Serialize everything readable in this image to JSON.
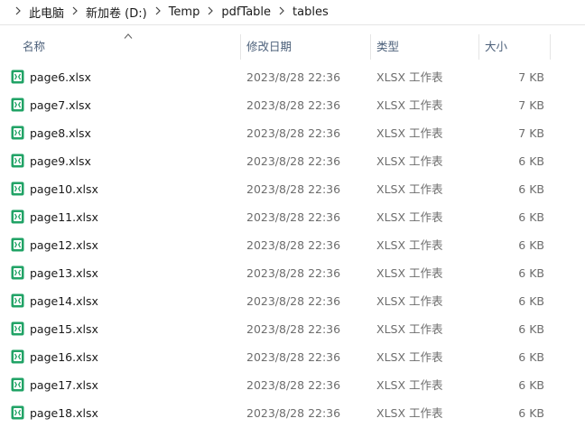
{
  "breadcrumb": [
    "此电脑",
    "新加卷 (D:)",
    "Temp",
    "pdfTable",
    "tables"
  ],
  "columns": {
    "name": "名称",
    "date": "修改日期",
    "type": "类型",
    "size": "大小"
  },
  "icons": {
    "breadcrumb_separator": "chevron-right-icon",
    "sort": "sort-ascending-icon",
    "file": "excel-file-icon"
  },
  "colors": {
    "file_icon": "#21a366",
    "header_text": "#4c607a",
    "secondary_text": "#6d6d6d"
  },
  "files": [
    {
      "name": "page6.xlsx",
      "date": "2023/8/28 22:36",
      "type": "XLSX 工作表",
      "size": "7 KB"
    },
    {
      "name": "page7.xlsx",
      "date": "2023/8/28 22:36",
      "type": "XLSX 工作表",
      "size": "7 KB"
    },
    {
      "name": "page8.xlsx",
      "date": "2023/8/28 22:36",
      "type": "XLSX 工作表",
      "size": "7 KB"
    },
    {
      "name": "page9.xlsx",
      "date": "2023/8/28 22:36",
      "type": "XLSX 工作表",
      "size": "6 KB"
    },
    {
      "name": "page10.xlsx",
      "date": "2023/8/28 22:36",
      "type": "XLSX 工作表",
      "size": "6 KB"
    },
    {
      "name": "page11.xlsx",
      "date": "2023/8/28 22:36",
      "type": "XLSX 工作表",
      "size": "6 KB"
    },
    {
      "name": "page12.xlsx",
      "date": "2023/8/28 22:36",
      "type": "XLSX 工作表",
      "size": "6 KB"
    },
    {
      "name": "page13.xlsx",
      "date": "2023/8/28 22:36",
      "type": "XLSX 工作表",
      "size": "6 KB"
    },
    {
      "name": "page14.xlsx",
      "date": "2023/8/28 22:36",
      "type": "XLSX 工作表",
      "size": "6 KB"
    },
    {
      "name": "page15.xlsx",
      "date": "2023/8/28 22:36",
      "type": "XLSX 工作表",
      "size": "6 KB"
    },
    {
      "name": "page16.xlsx",
      "date": "2023/8/28 22:36",
      "type": "XLSX 工作表",
      "size": "6 KB"
    },
    {
      "name": "page17.xlsx",
      "date": "2023/8/28 22:36",
      "type": "XLSX 工作表",
      "size": "6 KB"
    },
    {
      "name": "page18.xlsx",
      "date": "2023/8/28 22:36",
      "type": "XLSX 工作表",
      "size": "6 KB"
    }
  ]
}
